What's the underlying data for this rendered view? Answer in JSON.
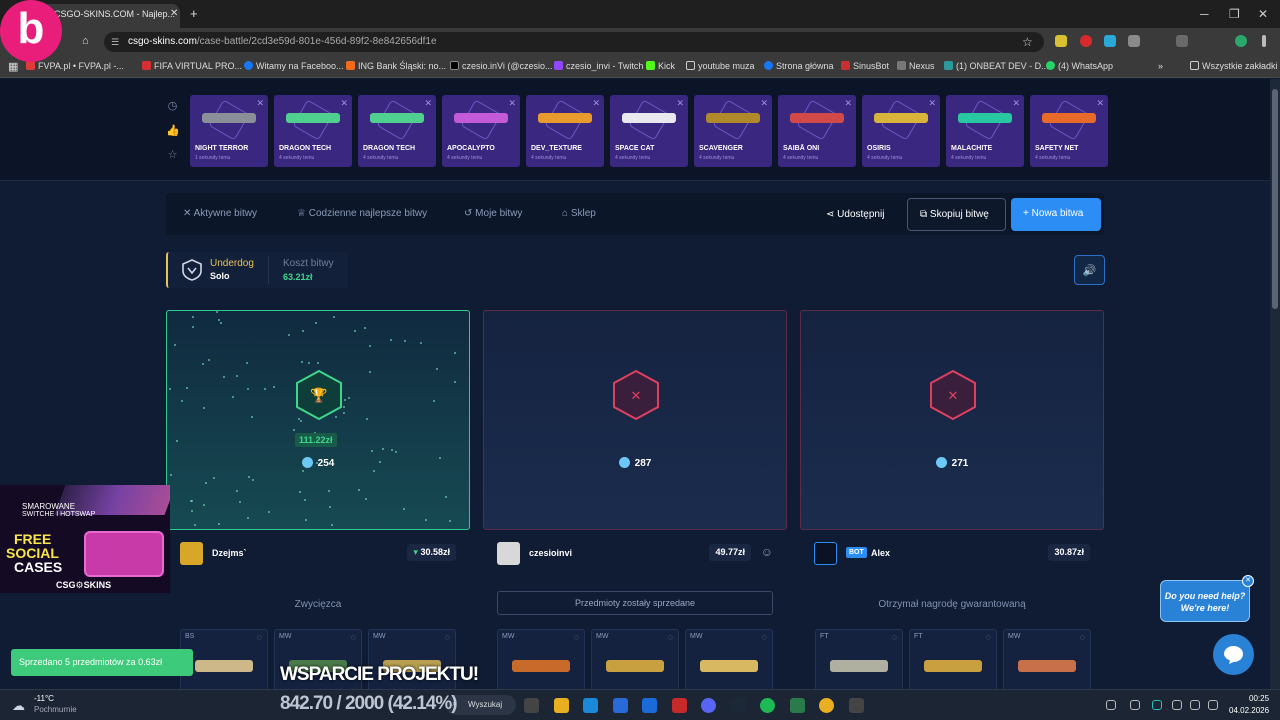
{
  "browser": {
    "tab_title": "CSGO-SKINS.COM - Najlep...",
    "url_domain": "csgo-skins.com",
    "url_path": "/case-battle/2cd3e59d-801e-456d-89f2-8e842656df1e",
    "bookmarks": [
      "FVPA.pl • FVPA.pl -...",
      "FIFA VIRTUAL PRO...",
      "Witamy na Faceboo...",
      "ING Bank Śląski: no...",
      "czesio.inVi (@czesio...",
      "czesio_invi - Twitch",
      "Kick",
      "youtube muza",
      "Strona główna",
      "SinusBot",
      "Nexus",
      "(1) ONBEAT DEV - D...",
      "(4) WhatsApp"
    ],
    "all_bookmarks": "Wszystkie zakładki"
  },
  "overlay_logo": "b",
  "live_drops": [
    {
      "name": "NIGHT TERROR",
      "time": "1 sekundy temu",
      "color": "#8a8f98"
    },
    {
      "name": "DRAGON TECH",
      "time": "4 sekundy temu",
      "color": "#4fd08f"
    },
    {
      "name": "DRAGON TECH",
      "time": "4 sekundy temu",
      "color": "#4fd08f"
    },
    {
      "name": "APOCALYPTO",
      "time": "4 sekundy temu",
      "color": "#c35ad8"
    },
    {
      "name": "DEV_TEXTURE",
      "time": "4 sekundy temu",
      "color": "#e89a2c"
    },
    {
      "name": "SPACE CAT",
      "time": "4 sekundy temu",
      "color": "#e8e8ee"
    },
    {
      "name": "SCAVENGER",
      "time": "4 sekundy temu",
      "color": "#b08a2a"
    },
    {
      "name": "SAIBĀ ONI",
      "time": "4 sekundy temu",
      "color": "#d24a48"
    },
    {
      "name": "OSIRIS",
      "time": "4 sekundy temu",
      "color": "#d8b43a"
    },
    {
      "name": "MALACHITE",
      "time": "4 sekundy temu",
      "color": "#27c7a2"
    },
    {
      "name": "SAFETY NET",
      "time": "4 sekundy temu",
      "color": "#e86a2a"
    }
  ],
  "nav": {
    "active": "Aktywne bitwy",
    "daily": "Codzienne najlepsze bitwy",
    "mine": "Moje bitwy",
    "shop": "Sklep",
    "share": "Udostępnij",
    "copy": "Skopiuj bitwę",
    "new": "Nowa bitwa"
  },
  "battle": {
    "mode": "Underdog",
    "type": "Solo",
    "cost_label": "Koszt bitwy",
    "cost": "63.21zł"
  },
  "players": [
    {
      "name": "Dzejms`",
      "amount": "30.58zł",
      "coins": "254",
      "win": "111.22zł",
      "status": "Zwycięzca",
      "avatar_color": "#d8a72a",
      "items": [
        "BS",
        "MW",
        "MW"
      ]
    },
    {
      "name": "czesioinvi",
      "amount": "49.77zł",
      "coins": "287",
      "status": "Przedmioty zostały sprzedane",
      "avatar_color": "#d8d8d8",
      "items": [
        "MW",
        "MW",
        "MW"
      ]
    },
    {
      "name": "Alex",
      "bot": "BOT",
      "amount": "30.87zł",
      "coins": "271",
      "status": "Otrzymał nagrodę gwarantowaną",
      "avatar_color": "#1a2742",
      "items": [
        "FT",
        "FT",
        "MW"
      ]
    }
  ],
  "ad": {
    "top": "SMAROWANE",
    "top2": "SWITCHE I HOTSWAP",
    "big1": "FREE",
    "big2": "SOCIAL",
    "big3": "CASES",
    "brand": "CSG⚙SKINS"
  },
  "toast": "Sprzedano 5 przedmiotów za 0.63zł",
  "stream_overlay": {
    "title": "WSPARCIE PROJEKTU!",
    "progress": "842.70 / 2000 (42.14%)"
  },
  "help": {
    "line1": "Do you need help?",
    "line2": "We're here!"
  },
  "taskbar": {
    "weather_temp": "-11°C",
    "weather_desc": "Pochmurnie",
    "search": "Wyszukaj",
    "time": "00:25",
    "date": "04.02.2026"
  }
}
